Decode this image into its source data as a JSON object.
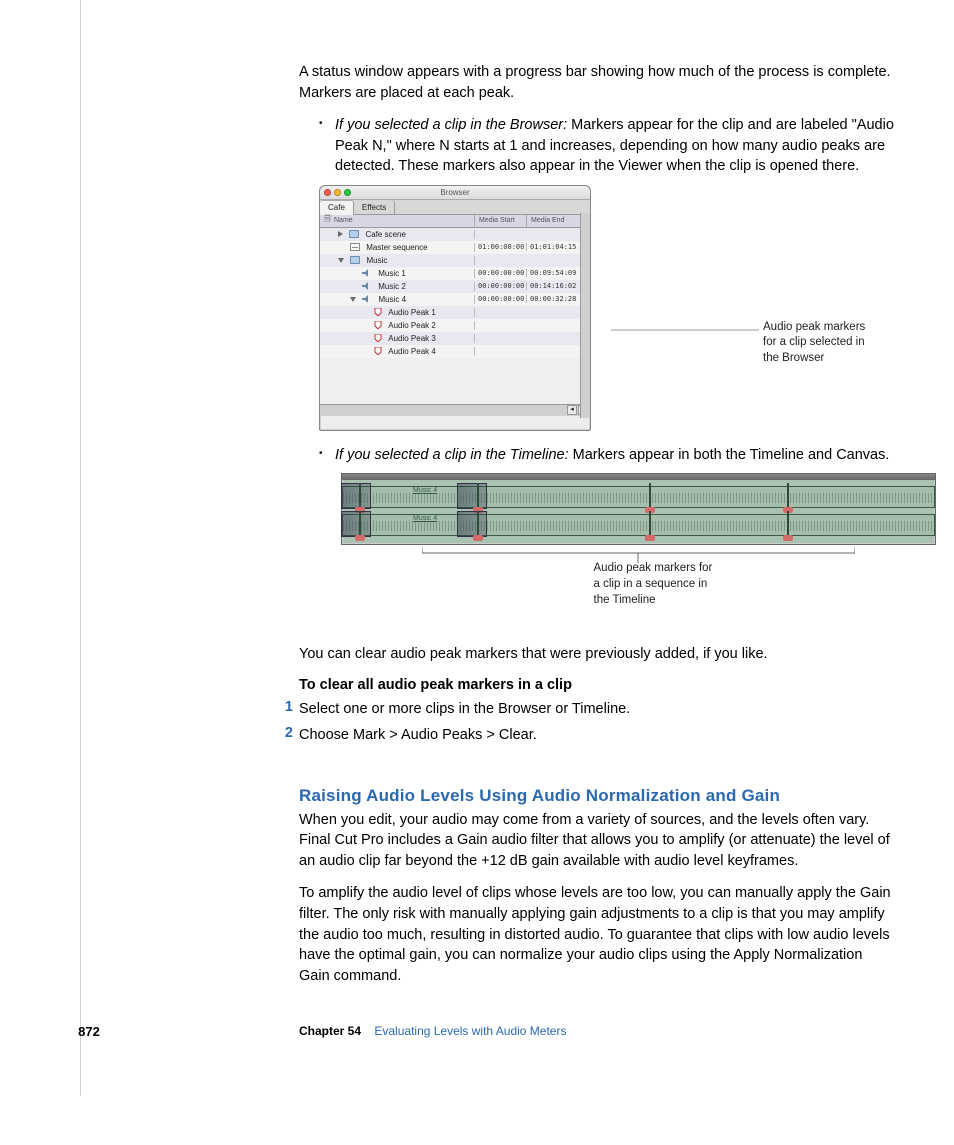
{
  "para1": "A status window appears with a progress bar showing how much of the process is complete. Markers are placed at each peak.",
  "bullet1_lead": "If you selected a clip in the Browser:",
  "bullet1_rest": " Markers appear for the clip and are labeled \"Audio Peak N,\" where N starts at 1 and increases, depending on how many audio peaks are detected. These markers also appear in the Viewer when the clip is opened there.",
  "bullet2_lead": "If you selected a clip in the Timeline:",
  "bullet2_rest": " Markers appear in both the Timeline and Canvas.",
  "para2": "You can clear audio peak markers that were previously added, if you like.",
  "task_title": "To clear all audio peak markers in a clip",
  "step1": "Select one or more clips in the Browser or Timeline.",
  "step2": "Choose Mark > Audio Peaks > Clear.",
  "heading": "Raising Audio Levels Using Audio Normalization and Gain",
  "para3": "When you edit, your audio may come from a variety of sources, and the levels often vary. Final Cut Pro includes a Gain audio filter that allows you to amplify (or attenuate) the level of an audio clip far beyond the +12 dB gain available with audio level keyframes.",
  "para4": "To amplify the audio level of clips whose levels are too low, you can manually apply the Gain filter. The only risk with manually applying gain adjustments to a clip is that you may amplify the audio too much, resulting in distorted audio. To guarantee that clips with low audio levels have the optimal gain, you can normalize your audio clips using the Apply Normalization Gain command.",
  "callout1_l1": "Audio peak markers",
  "callout1_l2": "for a clip selected in",
  "callout1_l3": "the Browser",
  "callout2_l1": "Audio peak markers for",
  "callout2_l2": "a clip in a sequence in",
  "callout2_l3": "the Timeline",
  "browser": {
    "title": "Browser",
    "tab1": "Cafe",
    "tab2": "Effects",
    "col_name": "Name",
    "col_ms": "Media Start",
    "col_me": "Media End",
    "rows": {
      "r1": {
        "name": "Cafe scene",
        "ms": "",
        "me": ""
      },
      "r2": {
        "name": "Master sequence",
        "ms": "01:00:00:00",
        "me": "01:01:04:15"
      },
      "r3": {
        "name": "Music",
        "ms": "",
        "me": ""
      },
      "r4": {
        "name": "Music 1",
        "ms": "00:00:00:00",
        "me": "00:09:54:09"
      },
      "r5": {
        "name": "Music 2",
        "ms": "00:00:00:00",
        "me": "00:14:16:02"
      },
      "r6": {
        "name": "Music 4",
        "ms": "00:00:00:00",
        "me": "00:00:32:28"
      },
      "r7": {
        "name": "Audio Peak 1"
      },
      "r8": {
        "name": "Audio Peak 2"
      },
      "r9": {
        "name": "Audio Peak 3"
      },
      "r10": {
        "name": "Audio Peak 4"
      }
    }
  },
  "timeline_label": "Music 4",
  "footer": {
    "page": "872",
    "chapter": "Chapter 54",
    "title": "Evaluating Levels with Audio Meters"
  }
}
